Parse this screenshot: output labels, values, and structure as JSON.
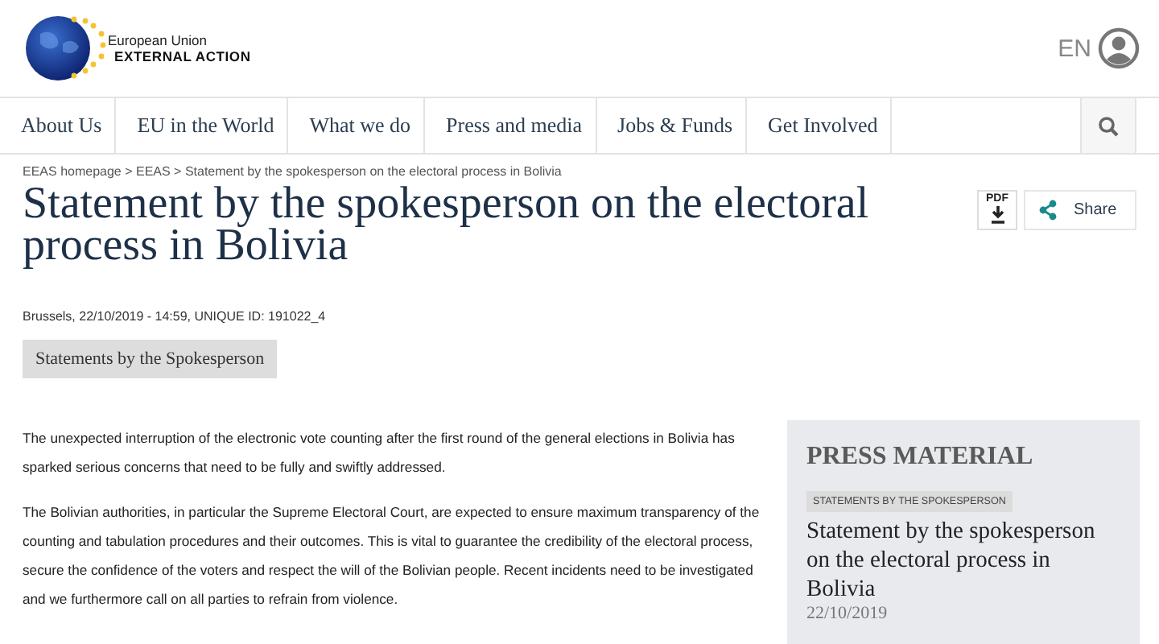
{
  "header": {
    "logo_line_1": "European Union",
    "logo_line_2": "EXTERNAL ACTION",
    "language": "EN"
  },
  "nav": {
    "items": [
      {
        "label": "About Us"
      },
      {
        "label": "EU in the World"
      },
      {
        "label": "What we do"
      },
      {
        "label": "Press and media"
      },
      {
        "label": "Jobs & Funds"
      },
      {
        "label": "Get Involved"
      }
    ]
  },
  "breadcrumb": "EEAS homepage > EEAS > Statement by the spokesperson on the electoral process in Bolivia",
  "article": {
    "title": "Statement by the spokesperson on the electoral process in Bolivia",
    "pdf_label": "PDF",
    "share_label": "Share",
    "meta": "Brussels, 22/10/2019 - 14:59, UNIQUE ID: 191022_4",
    "tag": "Statements by the Spokesperson",
    "paragraphs": [
      "The unexpected interruption of the electronic vote counting after the first round of the general elections in Bolivia has sparked serious concerns that need to be fully and swiftly addressed.",
      "The Bolivian authorities, in particular the Supreme Electoral Court, are expected to ensure maximum transparency of the counting and tabulation procedures and their outcomes. This is vital to guarantee the credibility of the electoral process, secure the confidence of the voters and respect the will of the Bolivian people. Recent incidents need to be investigated and we furthermore call on all parties to refrain from violence."
    ]
  },
  "press_material": {
    "heading": "PRESS MATERIAL",
    "items": [
      {
        "tag": "STATEMENTS BY THE SPOKESPERSON",
        "title": "Statement by the spokesperson on the electoral process in Bolivia",
        "date": "22/10/2019"
      }
    ]
  }
}
